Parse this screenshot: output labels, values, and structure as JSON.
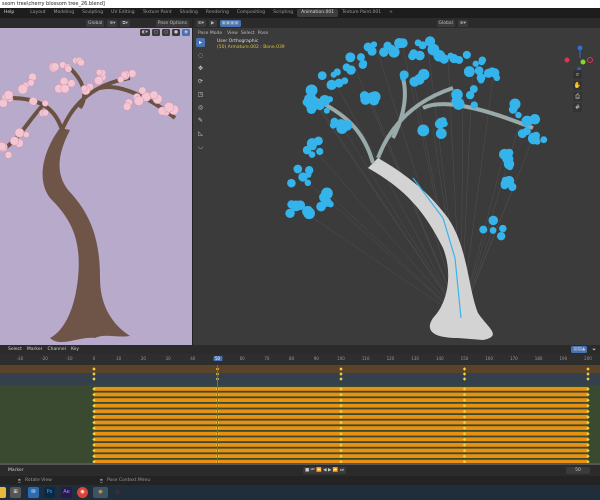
{
  "window_title": "ssom tree\\cherry blossom tree_26.blend]",
  "menu": {
    "help": "Help"
  },
  "workspace_tabs": [
    "Layout",
    "Modeling",
    "Sculpting",
    "UV Editing",
    "Texture Paint",
    "Shading",
    "Rendering",
    "Compositing",
    "Scripting",
    "Animation.001",
    "Texture Paint.001",
    "+"
  ],
  "active_tab": "Animation.001",
  "left_viewport": {
    "orientation": "Global",
    "pose_options": "Pose Options"
  },
  "right_viewport": {
    "mode": "Pose Mode",
    "menus": [
      "View",
      "Select",
      "Pose"
    ],
    "orientation": "Global",
    "view_name": "User Orthographic",
    "info": "(50) Armature.002 : Bone.039"
  },
  "dopesheet": {
    "menus": [
      "Select",
      "Marker",
      "Channel",
      "Key"
    ],
    "ruler": [
      "-30",
      "-20",
      "-10",
      "0",
      "10",
      "20",
      "30",
      "40",
      "50",
      "60",
      "70",
      "80",
      "90",
      "100",
      "110",
      "120",
      "130",
      "140",
      "150",
      "160",
      "170",
      "180",
      "190",
      "200"
    ],
    "current_frame": "50",
    "keyframes": [
      0,
      50,
      100,
      150,
      200
    ]
  },
  "playback": {
    "marker": "Marker",
    "frame": "50"
  },
  "status": {
    "left": "Rotate View",
    "right": "Pose Context Menu"
  },
  "colors": {
    "accent": "#4772b3",
    "keyframe_bar": "#e8900f",
    "foliage": "#35b4ec",
    "blossom": "#f3c6d4"
  }
}
